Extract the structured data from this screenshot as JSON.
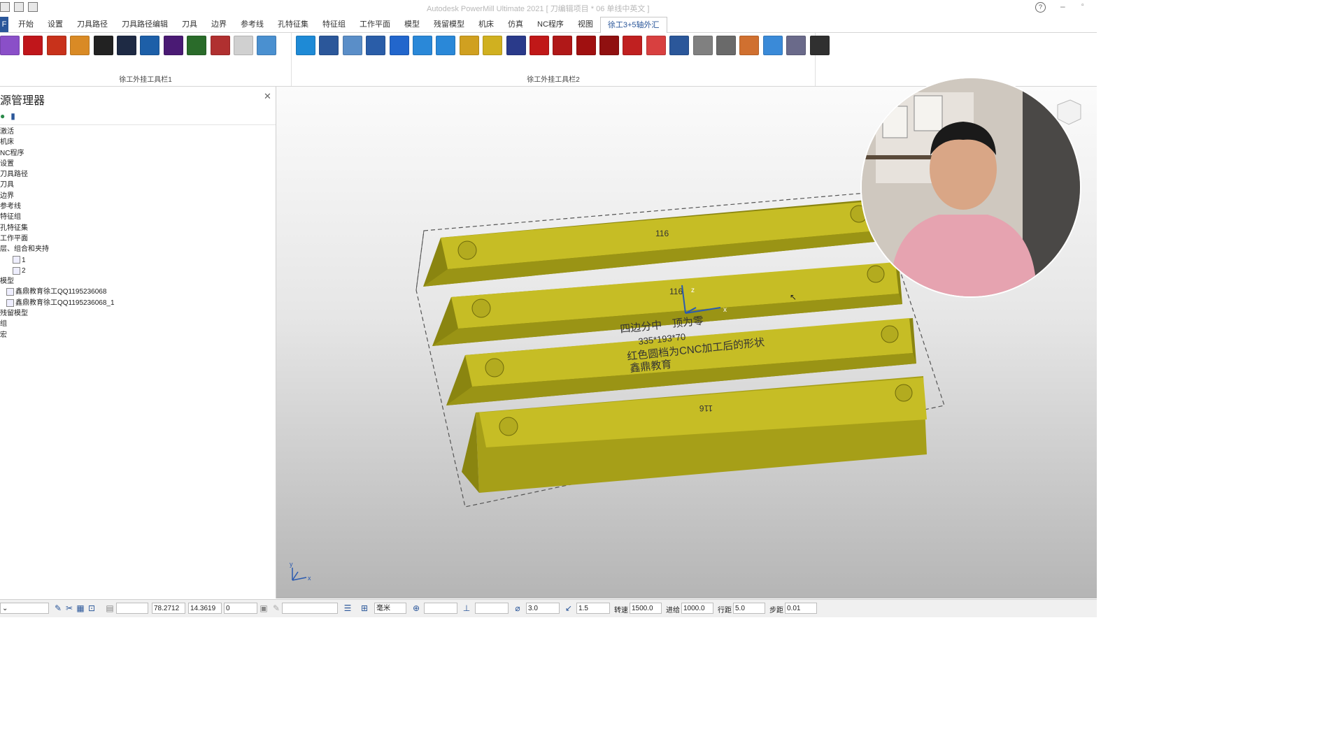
{
  "window": {
    "title": "Autodesk PowerMill Ultimate 2021   [ 刀编辑项目 * 06 单线中英文 ]"
  },
  "ribbon": {
    "file_tab": "F",
    "tabs": [
      "开始",
      "设置",
      "刀具路径",
      "刀具路径编辑",
      "刀具",
      "边界",
      "参考线",
      "孔特征集",
      "特征组",
      "工作平面",
      "模型",
      "残留模型",
      "机床",
      "仿真",
      "NC程序",
      "视图",
      "徐工3+5轴外汇"
    ],
    "active_tab": "徐工3+5轴外汇",
    "group1_label": "徐工外挂工具栏1",
    "group2_label": "徐工外挂工具栏2",
    "group1_icons": [
      "#8a4fc8",
      "#c0161b",
      "#c8321b",
      "#d98a25",
      "#222222",
      "#1e2a44",
      "#1d5fa8",
      "#4a1a74",
      "#2a6b2a",
      "#b03030",
      "#d0d0d0",
      "#4a90d0"
    ],
    "group2_icons": [
      "#1e8ad6",
      "#2b579a",
      "#5a8ec8",
      "#2a5da8",
      "#2266cc",
      "#2a88d8",
      "#2a88d8",
      "#d0a020",
      "#d0b020",
      "#2a3a8a",
      "#c01818",
      "#b01818",
      "#a01010",
      "#901010",
      "#c02020",
      "#d84040",
      "#2b579a",
      "#808080",
      "#6a6a6a",
      "#d07030",
      "#3a8ad8",
      "#6a6a8a",
      "#303030"
    ]
  },
  "panel": {
    "title": "源管理器",
    "tree": [
      {
        "label": "激活"
      },
      {
        "label": "机床"
      },
      {
        "label": "NC程序"
      },
      {
        "label": "设置"
      },
      {
        "label": "刀具路径"
      },
      {
        "label": "刀具"
      },
      {
        "label": "边界"
      },
      {
        "label": "参考线"
      },
      {
        "label": "特征组"
      },
      {
        "label": "孔特征集"
      },
      {
        "label": "工作平面"
      },
      {
        "label": "层、组合和夹持"
      },
      {
        "label": "1",
        "indent": 2
      },
      {
        "label": "2",
        "indent": 2
      },
      {
        "label": "模型"
      },
      {
        "label": "鑫鼎教育徐工QQ1195236068",
        "indent": 1
      },
      {
        "label": "鑫鼎教育徐工QQ1195236068_1",
        "indent": 1
      },
      {
        "label": "残留模型"
      },
      {
        "label": "组"
      },
      {
        "label": "宏"
      }
    ]
  },
  "viewport": {
    "labels": {
      "num1": "116",
      "num2": "116",
      "num3": "116",
      "axis_z": "z",
      "axis_x": "x",
      "axis_y": "y",
      "note1": "四边分中　顶为零",
      "note2": "335*193*70",
      "note3": "红色圆档为CNC加工后的形状",
      "note4": "鑫鼎教育"
    }
  },
  "status": {
    "coord1": "78.2712",
    "coord2": "14.3619",
    "coord3": "0",
    "units": "毫米",
    "diameter": "3.0",
    "tolerance": "1.5",
    "speed_label": "转速",
    "speed": "1500.0",
    "feed_label": "进给",
    "feed": "1000.0",
    "step_label": "行距",
    "step": "5.0",
    "depth_label": "步距",
    "depth": "0.01"
  }
}
